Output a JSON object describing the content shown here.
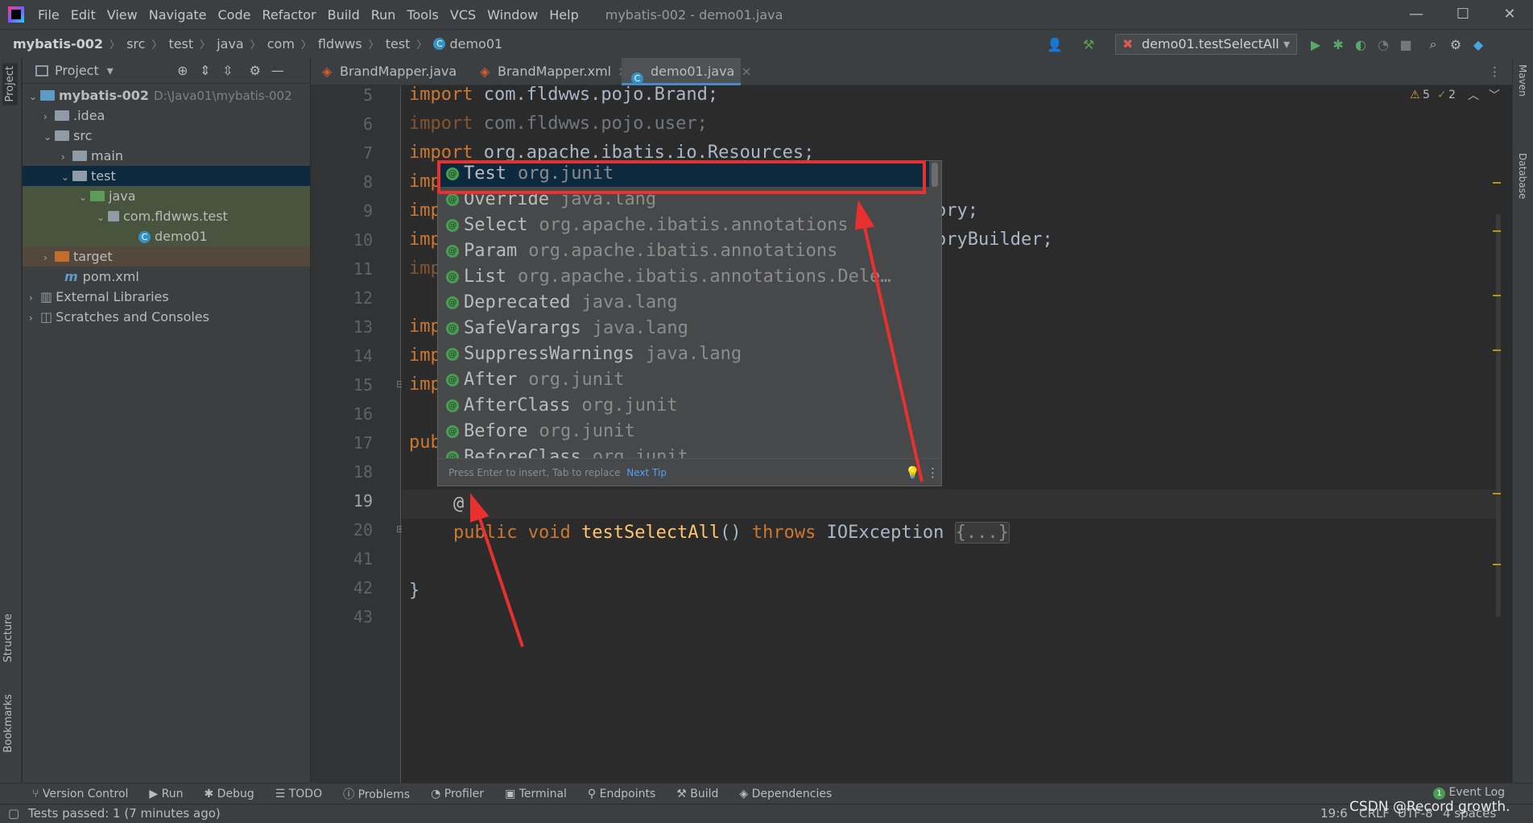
{
  "titlebar": {
    "menus": [
      "File",
      "Edit",
      "View",
      "Navigate",
      "Code",
      "Refactor",
      "Build",
      "Run",
      "Tools",
      "VCS",
      "Window",
      "Help"
    ],
    "window_title": "mybatis-002 - demo01.java",
    "controls": [
      "—",
      "☐",
      "✕"
    ]
  },
  "navbar": {
    "crumbs": [
      "mybatis-002",
      "src",
      "test",
      "java",
      "com",
      "fldwws",
      "test",
      "demo01"
    ],
    "run_config": "demo01.testSelectAll"
  },
  "left_strip": {
    "project": "Project",
    "structure": "Structure",
    "bookmarks": "Bookmarks"
  },
  "right_strip": {
    "maven": "Maven",
    "database": "Database"
  },
  "project_panel": {
    "title": "Project",
    "tree": [
      {
        "label": "mybatis-002",
        "hint": "D:\\Java01\\mybatis-002"
      },
      {
        "label": ".idea"
      },
      {
        "label": "src"
      },
      {
        "label": "main"
      },
      {
        "label": "test"
      },
      {
        "label": "java"
      },
      {
        "label": "com.fldwws.test"
      },
      {
        "label": "demo01"
      },
      {
        "label": "target"
      },
      {
        "label": "pom.xml"
      },
      {
        "label": "External Libraries"
      },
      {
        "label": "Scratches and Consoles"
      }
    ]
  },
  "tabs": [
    {
      "label": "BrandMapper.java"
    },
    {
      "label": "BrandMapper.xml"
    },
    {
      "label": "demo01.java",
      "active": true
    }
  ],
  "editor": {
    "line_numbers": [
      "5",
      "6",
      "7",
      "8",
      "9",
      "10",
      "11",
      "12",
      "13",
      "14",
      "15",
      "16",
      "17",
      "18",
      "19",
      "20",
      "41",
      "42",
      "43"
    ],
    "inspections": {
      "warnings": "5",
      "checks": "2"
    },
    "lines": {
      "l5": {
        "kw": "import",
        "rest": " com.fldwws.pojo.Brand;"
      },
      "l6": {
        "kw": "import",
        "rest": " com.fldwws.pojo.user;"
      },
      "l7": {
        "kw": "import",
        "rest": " org.apache.ibatis.io.Resources;"
      },
      "l8": "imp",
      "l9": "imp",
      "l9_tail": "ory;",
      "l10": "imp",
      "l10_tail": "oryBuilder;",
      "l11": "imp",
      "l13": "imp",
      "l14": "imp",
      "l15": "imp",
      "l17": "pub",
      "l19": "@",
      "l20": {
        "kw1": "public",
        "kw2": "void",
        "name": "testSelectAll",
        "args": "()",
        "kw3": "throws",
        "exc": "IOException",
        "fold": "{...}"
      },
      "l42": "}"
    }
  },
  "completion": {
    "items": [
      {
        "name": "Test",
        "pkg": "org.junit"
      },
      {
        "name": "Override",
        "pkg": "java.lang"
      },
      {
        "name": "Select",
        "pkg": "org.apache.ibatis.annotations"
      },
      {
        "name": "Param",
        "pkg": "org.apache.ibatis.annotations"
      },
      {
        "name": "List",
        "pkg": "org.apache.ibatis.annotations.Dele…"
      },
      {
        "name": "Deprecated",
        "pkg": "java.lang"
      },
      {
        "name": "SafeVarargs",
        "pkg": "java.lang"
      },
      {
        "name": "SuppressWarnings",
        "pkg": "java.lang"
      },
      {
        "name": "After",
        "pkg": "org.junit"
      },
      {
        "name": "AfterClass",
        "pkg": "org.junit"
      },
      {
        "name": "Before",
        "pkg": "org.junit"
      },
      {
        "name": "BeforeClass",
        "pkg": "org.junit"
      }
    ],
    "footer": "Press Enter to insert, Tab to replace",
    "next_tip": "Next Tip"
  },
  "bottom_tools": [
    "Version Control",
    "Run",
    "Debug",
    "TODO",
    "Problems",
    "Profiler",
    "Terminal",
    "Endpoints",
    "Build",
    "Dependencies"
  ],
  "event_log": "Event Log",
  "event_count": "1",
  "status": {
    "message": "Tests passed: 1 (7 minutes ago)",
    "position": "19:6",
    "line_sep": "CRLF",
    "encoding": "UTF-8",
    "indent": "4 spaces",
    "watermark": "CSDN @Record growth."
  },
  "colors": {
    "accent": "#4a88c7",
    "annotation": "#e8302e",
    "keyword": "#cc7832"
  }
}
